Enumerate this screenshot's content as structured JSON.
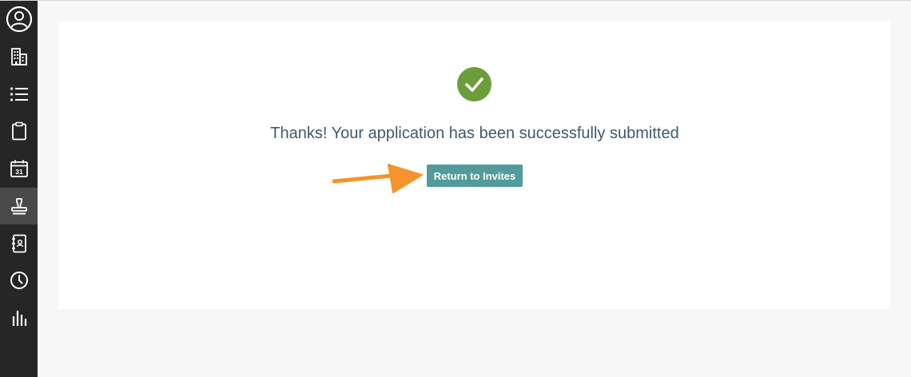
{
  "sidebar": {
    "items": [
      {
        "icon": "user-circle-icon"
      },
      {
        "icon": "building-icon"
      },
      {
        "icon": "list-icon"
      },
      {
        "icon": "clipboard-icon"
      },
      {
        "icon": "calendar-icon",
        "label": "31"
      },
      {
        "icon": "stamp-icon",
        "active": true
      },
      {
        "icon": "address-book-icon"
      },
      {
        "icon": "clock-icon"
      },
      {
        "icon": "bar-chart-icon"
      }
    ]
  },
  "confirmation": {
    "message": "Thanks! Your application has been successfully submitted",
    "button_label": "Return to Invites",
    "icon": "check-circle-icon"
  },
  "colors": {
    "sidebar_bg": "#262626",
    "sidebar_active": "#4a4a4a",
    "success_green": "#6b9e3a",
    "button_teal": "#539b9b",
    "message_text": "#40596b",
    "annotation_arrow": "#f3942c"
  }
}
